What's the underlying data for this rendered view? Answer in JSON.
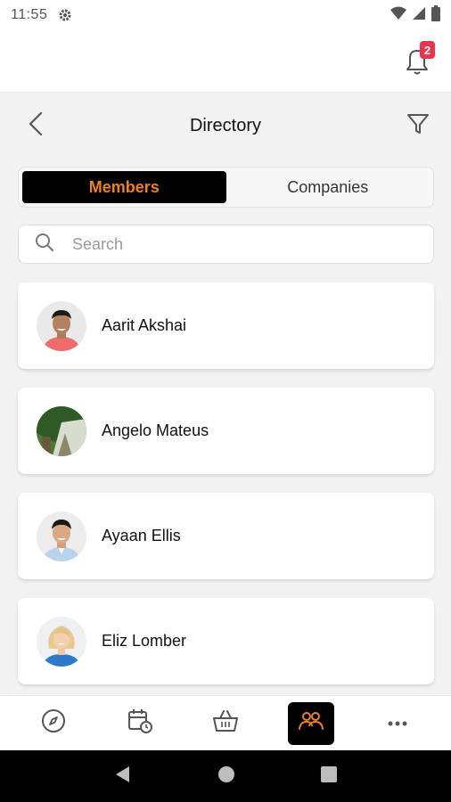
{
  "status_bar": {
    "time": "11:55",
    "icons": [
      "gear-icon",
      "wifi-icon",
      "signal-icon",
      "battery-icon"
    ]
  },
  "notifications": {
    "count": "2",
    "icon": "bell-icon"
  },
  "header": {
    "title": "Directory",
    "back_icon": "chevron-left-icon",
    "filter_icon": "filter-icon"
  },
  "tabs": [
    {
      "label": "Members",
      "active": true
    },
    {
      "label": "Companies",
      "active": false
    }
  ],
  "search": {
    "placeholder": "Search",
    "value": ""
  },
  "members": [
    {
      "name": "Aarit Akshai"
    },
    {
      "name": "Angelo Mateus"
    },
    {
      "name": "Ayaan Ellis"
    },
    {
      "name": "Eliz Lomber"
    }
  ],
  "bottom_nav": [
    {
      "icon": "compass-icon",
      "active": false
    },
    {
      "icon": "calendar-clock-icon",
      "active": false
    },
    {
      "icon": "basket-icon",
      "active": false
    },
    {
      "icon": "people-icon",
      "active": true
    },
    {
      "icon": "more-icon",
      "active": false
    }
  ],
  "colors": {
    "accent": "#f07f1d",
    "active_bg": "#000000",
    "badge": "#e8344f",
    "background": "#f2f2f2"
  }
}
